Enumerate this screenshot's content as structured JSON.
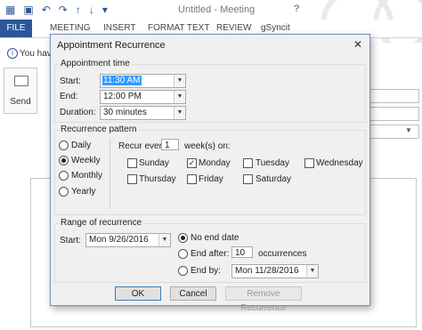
{
  "window": {
    "title": "Untitled - Meeting",
    "help": "?",
    "qat_icons": [
      "calendar-icon",
      "save-icon",
      "undo-icon",
      "redo-icon",
      "up-arrow-icon",
      "down-arrow-icon",
      "customize-icon"
    ],
    "qat_glyphs": [
      "▦",
      "▣",
      "↶",
      "↷",
      "↑",
      "↓",
      "▾"
    ]
  },
  "ribbon": {
    "file": "FILE",
    "tabs": [
      "MEETING",
      "INSERT",
      "FORMAT TEXT",
      "REVIEW",
      "gSyncit"
    ]
  },
  "infobar": {
    "text": "You hav"
  },
  "send": {
    "label": "Send"
  },
  "dialog": {
    "title": "Appointment Recurrence",
    "close": "✕",
    "appointment_time": {
      "legend": "Appointment time",
      "start_label": "Start:",
      "start_value": "11:30 AM",
      "end_label": "End:",
      "end_value": "12:00 PM",
      "duration_label": "Duration:",
      "duration_value": "30 minutes"
    },
    "pattern": {
      "legend": "Recurrence pattern",
      "options": [
        "Daily",
        "Weekly",
        "Monthly",
        "Yearly"
      ],
      "selected": "Weekly",
      "recur_every_label": "Recur every",
      "recur_every_value": "1",
      "weeks_on_label": "week(s) on:",
      "days": [
        {
          "label": "Sunday",
          "checked": false
        },
        {
          "label": "Monday",
          "checked": true
        },
        {
          "label": "Tuesday",
          "checked": false
        },
        {
          "label": "Wednesday",
          "checked": false
        },
        {
          "label": "Thursday",
          "checked": false
        },
        {
          "label": "Friday",
          "checked": false
        },
        {
          "label": "Saturday",
          "checked": false
        }
      ]
    },
    "range": {
      "legend": "Range of recurrence",
      "start_label": "Start:",
      "start_value": "Mon 9/26/2016",
      "no_end_label": "No end date",
      "end_after_label": "End after:",
      "end_after_value": "10",
      "occurrences_label": "occurrences",
      "end_by_label": "End by:",
      "end_by_value": "Mon 11/28/2016",
      "selected": "No end date"
    },
    "buttons": {
      "ok": "OK",
      "cancel": "Cancel",
      "remove": "Remove Recurrence"
    }
  },
  "colors": {
    "accent": "#2b579a",
    "selection": "#3399ff",
    "dialog_bg": "#f0f0f0"
  }
}
